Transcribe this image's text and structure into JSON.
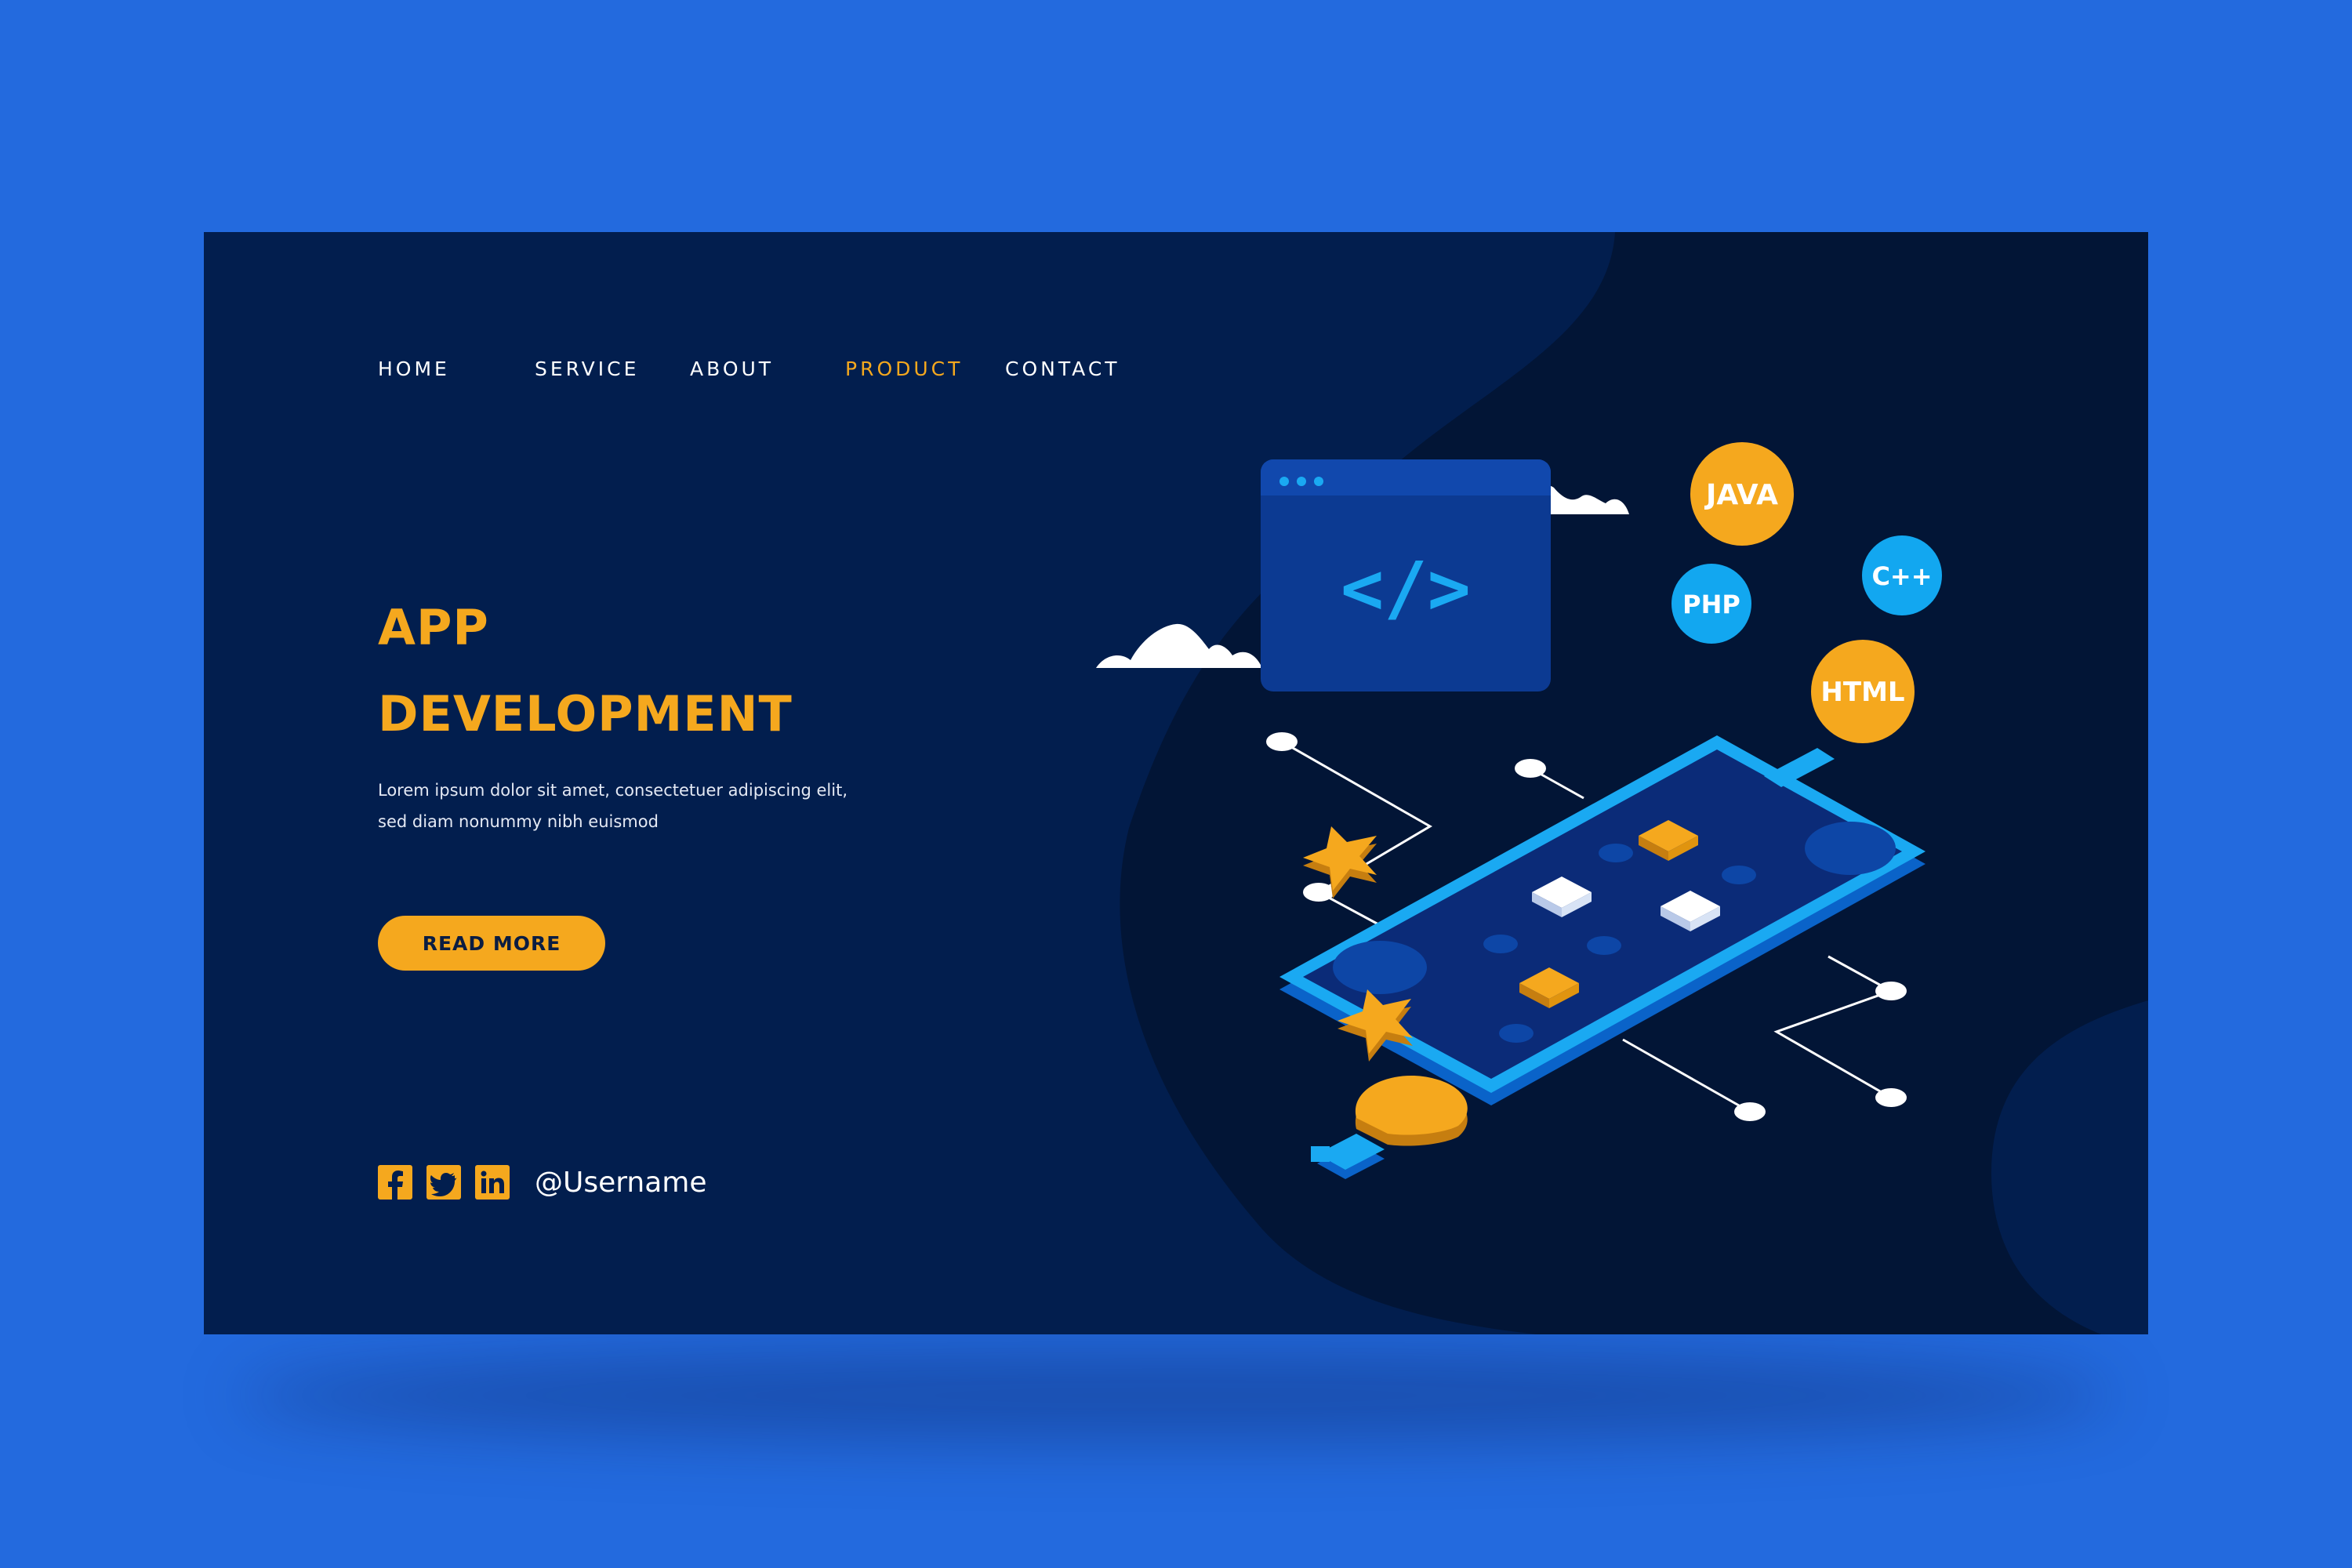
{
  "colors": {
    "page_background": "#236ade",
    "card_background": "#021e4e",
    "accent": "#f5a81e",
    "light_blue": "#12a7f0",
    "dark_shape": "#021536"
  },
  "nav": {
    "items": [
      {
        "label": "HOME",
        "active": false
      },
      {
        "label": "SERVICE",
        "active": false
      },
      {
        "label": "ABOUT",
        "active": false
      },
      {
        "label": "PRODUCT",
        "active": true
      },
      {
        "label": "CONTACT",
        "active": false
      }
    ]
  },
  "hero": {
    "title_line1": "APP",
    "title_line2": "DEVELOPMENT",
    "description": "Lorem ipsum dolor sit amet, consectetuer adipiscing elit, sed diam nonummy nibh euismod",
    "button_label": "READ MORE"
  },
  "social": {
    "icons": [
      "facebook-icon",
      "twitter-icon",
      "linkedin-icon"
    ],
    "username": "@Username"
  },
  "illustration": {
    "code_window_symbol": "</>",
    "languages": [
      "JAVA",
      "PHP",
      "C++",
      "HTML"
    ]
  }
}
